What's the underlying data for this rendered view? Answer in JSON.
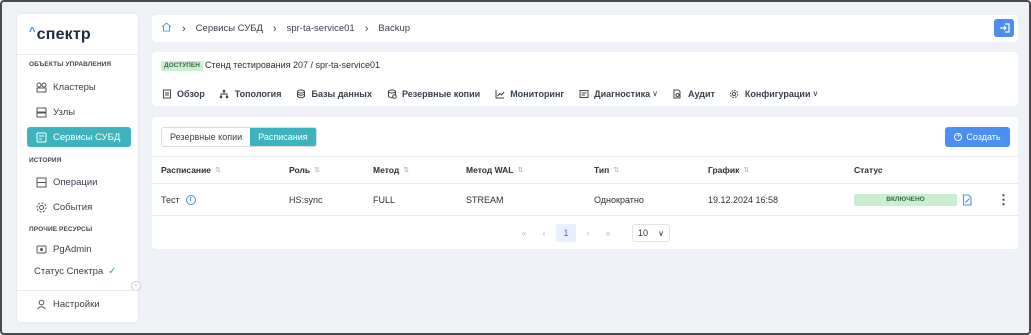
{
  "app": {
    "logo_text": "спектр"
  },
  "sidebar": {
    "section_objects": "ОБЪЕКТЫ УПРАВЛЕНИЯ",
    "section_history": "ИСТОРИЯ",
    "section_resources": "ПРОЧИЕ РЕСУРСЫ",
    "items": [
      {
        "label": "Кластеры",
        "icon": "cluster-icon"
      },
      {
        "label": "Узлы",
        "icon": "server-icon"
      },
      {
        "label": "Сервисы СУБД",
        "icon": "db-service-icon",
        "active": true
      },
      {
        "label": "Операции",
        "icon": "operations-icon"
      },
      {
        "label": "События",
        "icon": "events-icon"
      },
      {
        "label": "PgAdmin",
        "icon": "pgadmin-icon"
      },
      {
        "label": "Статус Спектра",
        "icon": "check-icon"
      },
      {
        "label": "Настройки",
        "icon": "user-icon"
      }
    ]
  },
  "breadcrumb": [
    "Сервисы СУБД",
    "spr-ta-service01",
    "Backup"
  ],
  "header": {
    "status_badge": "ДОСТУПЕН",
    "path": "Стенд тестирования 207 /  spr-ta-service01",
    "tabs": [
      {
        "label": "Обзор",
        "icon": "overview-icon"
      },
      {
        "label": "Топология",
        "icon": "topology-icon"
      },
      {
        "label": "Базы данных",
        "icon": "database-icon"
      },
      {
        "label": "Резервные копии",
        "icon": "backup-icon"
      },
      {
        "label": "Мониторинг",
        "icon": "chart-icon"
      },
      {
        "label": "Диагностика",
        "icon": "diagnostics-icon",
        "dropdown": true
      },
      {
        "label": "Аудит",
        "icon": "audit-icon"
      },
      {
        "label": "Конфигурации",
        "icon": "gear-icon",
        "dropdown": true
      }
    ]
  },
  "content": {
    "segments": [
      "Резервные копии",
      "Расписания"
    ],
    "active_segment": "Расписания",
    "create_label": "Создать",
    "table": {
      "columns": [
        "Расписание",
        "Роль",
        "Метод",
        "Метод WAL",
        "Тип",
        "График",
        "Статус"
      ],
      "rows": [
        {
          "name": "Тест",
          "role": "HS:sync",
          "method": "FULL",
          "wal_method": "STREAM",
          "type": "Однократно",
          "schedule": "19.12.2024 16:58",
          "status": "ВКЛЮЧЕНО"
        }
      ]
    },
    "pagination": {
      "current_page": "1",
      "page_size": "10"
    }
  },
  "colors": {
    "accent": "#3db4bd",
    "primary": "#4b8ff0",
    "success_bg": "#c9efd0"
  }
}
